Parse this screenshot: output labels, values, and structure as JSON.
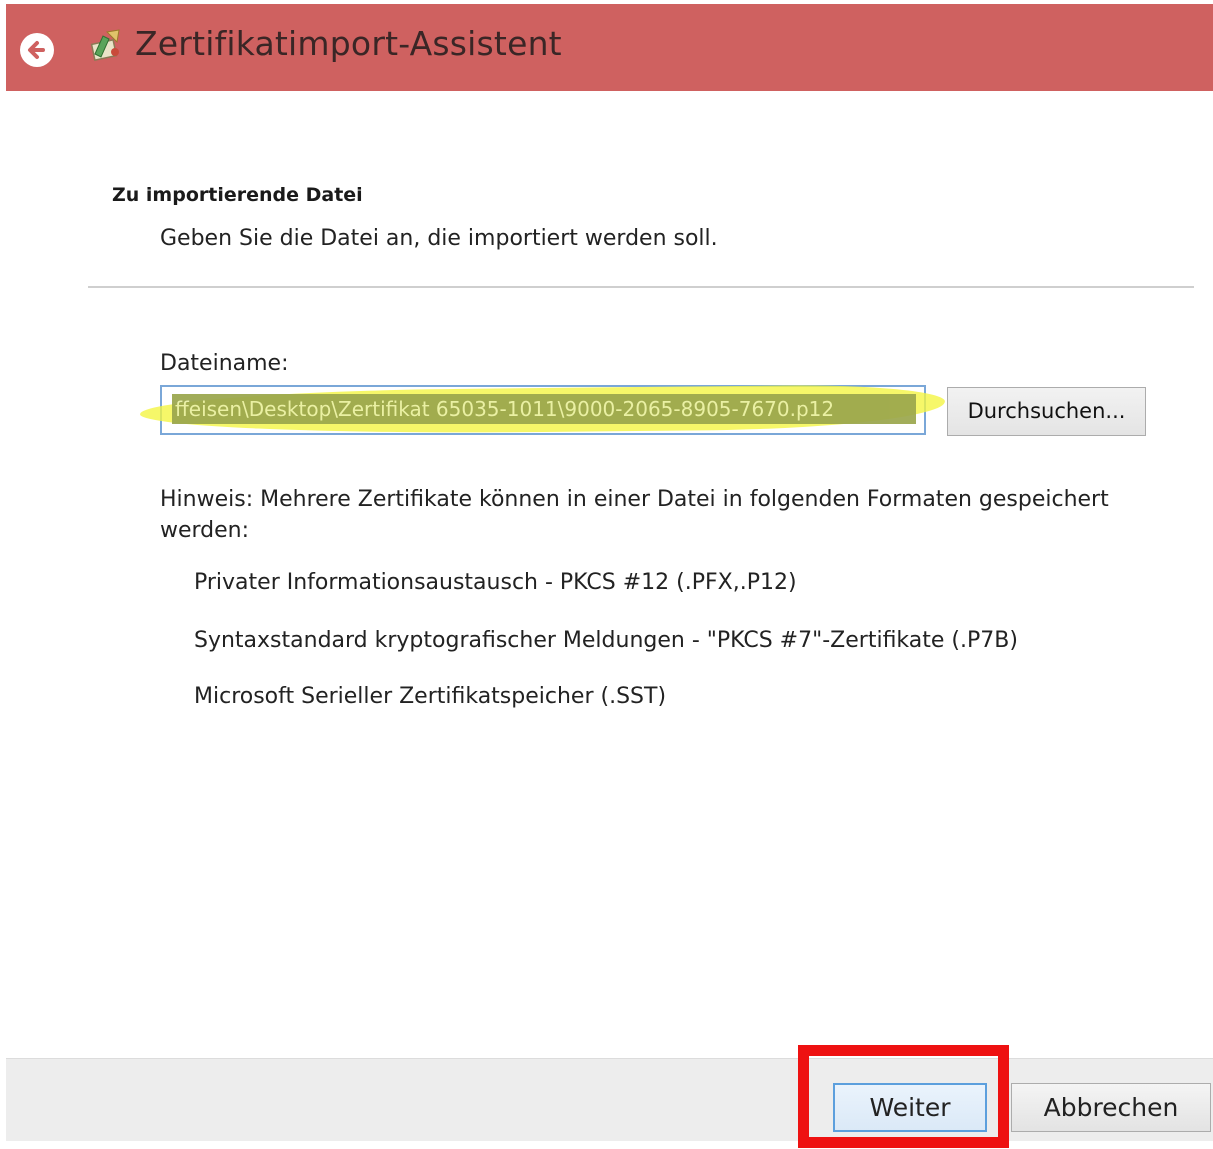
{
  "window": {
    "title": "Zertifikatimport-Assistent",
    "titlebar_color": "#cf6160"
  },
  "header": {
    "heading": "Zu importierende Datei",
    "subheading": "Geben Sie die Datei an, die importiert werden soll."
  },
  "form": {
    "filename_label": "Dateiname:",
    "filename_value": "ffeisen\\Desktop\\Zertifikat 65035-1011\\9000-2065-8905-7670.p12",
    "browse_label": "Durchsuchen..."
  },
  "hint": {
    "text": "Hinweis: Mehrere Zertifikate können in einer Datei in folgenden Formaten gespeichert werden:",
    "formats": [
      "Privater Informationsaustausch - PKCS #12 (.PFX,.P12)",
      "Syntaxstandard kryptografischer Meldungen - \"PKCS #7\"-Zertifikate (.P7B)",
      "Microsoft Serieller Zertifikatspeicher (.SST)"
    ]
  },
  "footer": {
    "next_label": "Weiter",
    "cancel_label": "Abbrechen"
  },
  "annotations": {
    "highlight_color": "#f4f53f",
    "callout_color": "#ee1111"
  },
  "icons": {
    "back": "back-arrow-icon",
    "app": "certificate-wizard-icon"
  }
}
